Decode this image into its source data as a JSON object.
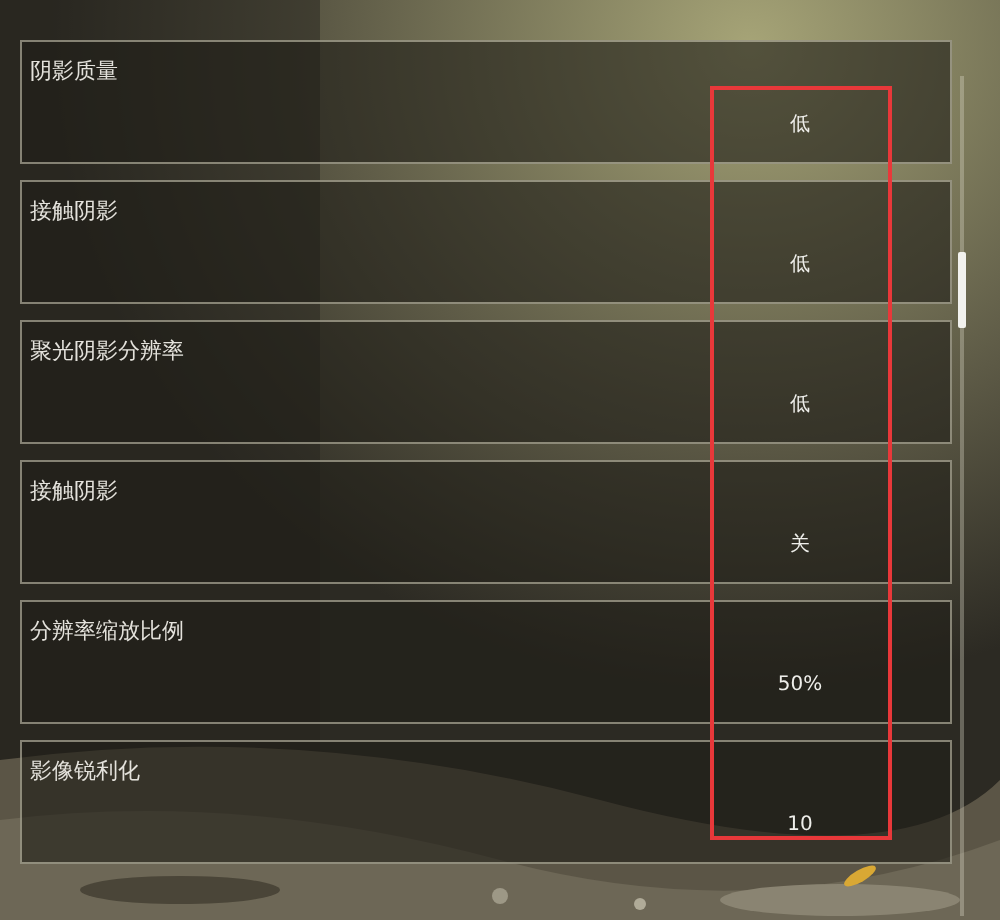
{
  "settings": [
    {
      "label": "阴影质量",
      "value": "低"
    },
    {
      "label": "接触阴影",
      "value": "低"
    },
    {
      "label": "聚光阴影分辨率",
      "value": "低"
    },
    {
      "label": "接触阴影",
      "value": "关"
    },
    {
      "label": "分辨率缩放比例",
      "value": "50%"
    },
    {
      "label": "影像锐利化",
      "value": "10"
    }
  ]
}
